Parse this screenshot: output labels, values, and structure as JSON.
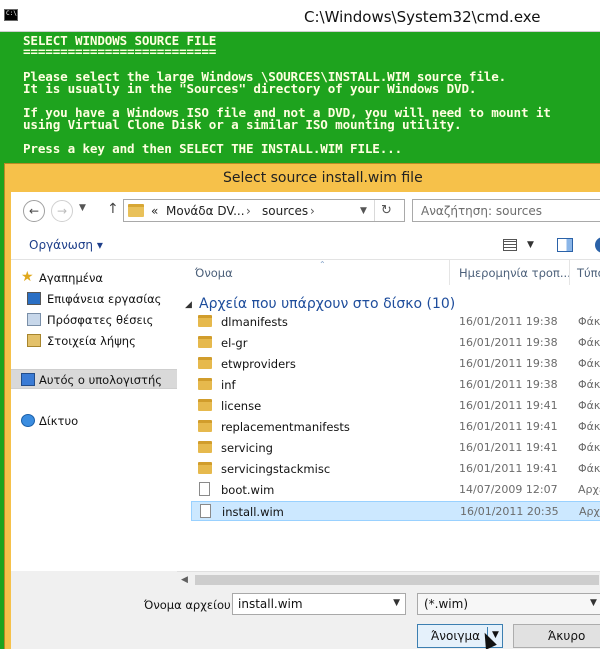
{
  "cmd": {
    "title": "C:\\Windows\\System32\\cmd.exe",
    "icon_label": "C:\\",
    "lines": [
      "SELECT WINDOWS SOURCE FILE",
      "==========================",
      "Please select the large Windows \\SOURCES\\INSTALL.WIM source file.",
      "It is usually in the \"Sources\" directory of your Windows DVD.",
      "If you have a Windows ISO file and not a DVD, you will need to mount it",
      "using Virtual Clone Disk or a similar ISO mounting utility.",
      "Press a key and then SELECT THE INSTALL.WIM FILE..."
    ]
  },
  "dialog": {
    "title": "Select source install.wim file",
    "nav": {
      "back_icon": "back-arrow-icon",
      "forward_icon": "forward-arrow-icon",
      "up_icon": "up-arrow-icon",
      "address_prefix": "«",
      "address_segments": [
        "Μονάδα DV...",
        "sources"
      ],
      "refresh_icon": "refresh-icon",
      "search_placeholder": "Αναζήτηση: sources"
    },
    "toolbar": {
      "organize_label": "Οργάνωση ▾"
    },
    "navpane": {
      "items": [
        {
          "label": "Αγαπημένα",
          "icon": "star-icon"
        },
        {
          "label": "Επιφάνεια εργασίας",
          "icon": "desktop-icon"
        },
        {
          "label": "Πρόσφατες θέσεις",
          "icon": "recent-places-icon"
        },
        {
          "label": "Στοιχεία λήψης",
          "icon": "downloads-icon"
        },
        {
          "label": "Αυτός ο υπολογιστής",
          "icon": "computer-icon"
        },
        {
          "label": "Δίκτυο",
          "icon": "network-icon"
        }
      ]
    },
    "filelist": {
      "columns": [
        "Όνομα",
        "Ημερομηνία τροπ...",
        "Τύπο"
      ],
      "group_label": "Αρχεία που υπάρχουν στο δίσκο (10)",
      "rows": [
        {
          "name": "dlmanifests",
          "date": "16/01/2011 19:38",
          "type": "Φάκελ",
          "kind": "folder"
        },
        {
          "name": "el-gr",
          "date": "16/01/2011 19:38",
          "type": "Φάκελ",
          "kind": "folder"
        },
        {
          "name": "etwproviders",
          "date": "16/01/2011 19:38",
          "type": "Φάκελ",
          "kind": "folder"
        },
        {
          "name": "inf",
          "date": "16/01/2011 19:38",
          "type": "Φάκελ",
          "kind": "folder"
        },
        {
          "name": "license",
          "date": "16/01/2011 19:41",
          "type": "Φάκελ",
          "kind": "folder"
        },
        {
          "name": "replacementmanifests",
          "date": "16/01/2011 19:41",
          "type": "Φάκελ",
          "kind": "folder"
        },
        {
          "name": "servicing",
          "date": "16/01/2011 19:41",
          "type": "Φάκελ",
          "kind": "folder"
        },
        {
          "name": "servicingstackmisc",
          "date": "16/01/2011 19:41",
          "type": "Φάκελ",
          "kind": "folder"
        },
        {
          "name": "boot.wim",
          "date": "14/07/2009 12:07",
          "type": "Αρχεί",
          "kind": "file"
        },
        {
          "name": "install.wim",
          "date": "16/01/2011 20:35",
          "type": "Αρχεί",
          "kind": "file",
          "selected": true
        }
      ]
    },
    "bottom": {
      "filename_label": "Όνομα αρχείου:",
      "filename_value": "install.wim",
      "filter_value": "(*.wim)",
      "open_label": "Άνοιγμα",
      "cancel_label": "Άκυρο"
    }
  }
}
